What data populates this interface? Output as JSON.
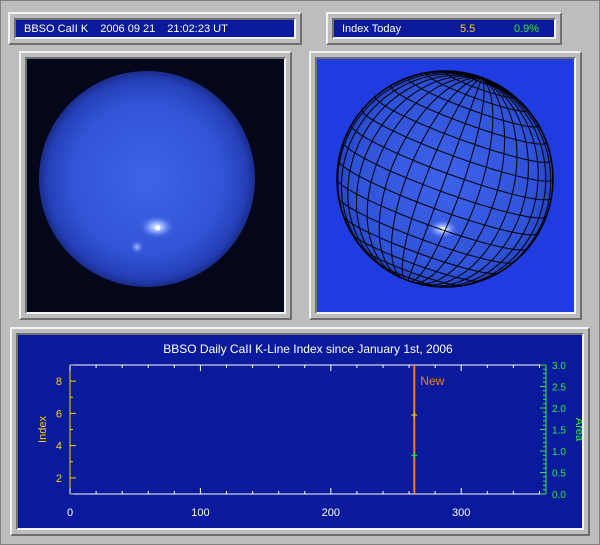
{
  "header": {
    "title": "BBSO CaII K",
    "date": "2006 09 21",
    "time": "21:02:23 UT",
    "index_label": "Index Today",
    "index_value": "5.5",
    "area_value": "0.9%",
    "colors": {
      "index_value": "#ffd400",
      "area_value": "#2cf02c"
    }
  },
  "images": {
    "left": {
      "icon": "sun-disk-image"
    },
    "right": {
      "icon": "sun-grid-image"
    }
  },
  "chart_data": {
    "type": "scatter",
    "title": "BBSO Daily CaII K-Line Index since January 1st, 2006",
    "xlabel": "",
    "ylabel_left": "Index",
    "ylabel_right": "Area",
    "xlim": [
      0,
      365
    ],
    "ylim_left": [
      1,
      9
    ],
    "ylim_right": [
      0,
      3
    ],
    "x_ticks": [
      0,
      100,
      200,
      300
    ],
    "y_left_ticks": [
      2,
      4,
      6,
      8
    ],
    "y_right_ticks": [
      0.0,
      0.5,
      1.0,
      1.5,
      2.0,
      2.5,
      3.0
    ],
    "marker_line": {
      "x": 264,
      "label": "New",
      "color": "#ff7a1a"
    },
    "series": [
      {
        "name": "Index",
        "axis": "left",
        "color": "#ffd400",
        "points": [
          [
            264,
            5.9
          ]
        ]
      },
      {
        "name": "Area",
        "axis": "right",
        "color": "#2cf02c",
        "points": [
          [
            264,
            0.9
          ]
        ]
      }
    ]
  }
}
